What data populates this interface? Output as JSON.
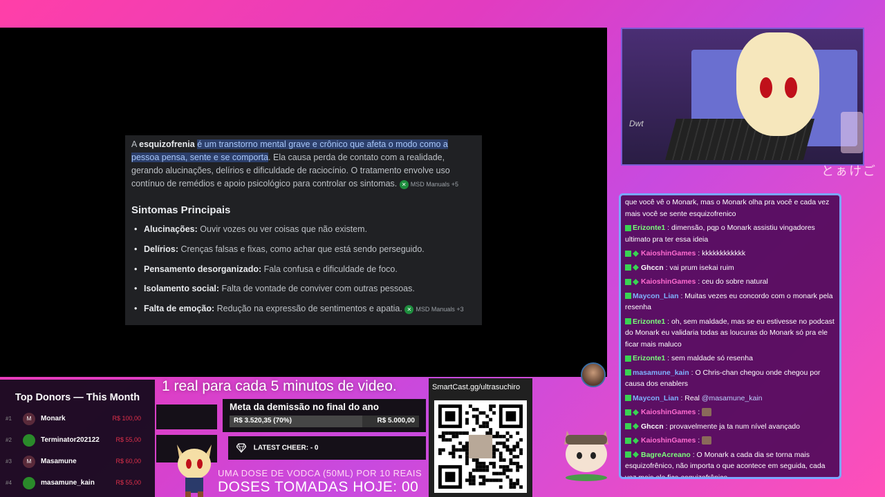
{
  "stream": {
    "card": {
      "p_pre": "A ",
      "p_term": "esquizofrenia",
      "p_hl": "é um transtorno mental grave e crônico que afeta o modo como a pessoa pensa, sente e se comporta",
      "p_rest": ". Ela causa perda de contato com a realidade, gerando alucinações, delírios e dificuldade de raciocínio. O tratamento envolve uso contínuo de remédios e apoio psicológico para controlar os sintomas.",
      "source1": "MSD Manuals +5",
      "heading": "Sintomas Principais",
      "items": [
        {
          "term": "Alucinações:",
          "desc": " Ouvir vozes ou ver coisas que não existem."
        },
        {
          "term": "Delírios:",
          "desc": " Crenças falsas e fixas, como achar que está sendo perseguido."
        },
        {
          "term": "Pensamento desorganizado:",
          "desc": " Fala confusa e dificuldade de foco."
        },
        {
          "term": "Isolamento social:",
          "desc": " Falta de vontade de conviver com outras pessoas."
        },
        {
          "term": "Falta de emoção:",
          "desc": " Redução na expressão de sentimentos e apatia."
        }
      ],
      "source2": "MSD Manuals +3"
    }
  },
  "overlay": {
    "jp_text": "とぁけご",
    "cam_sign": "Dwt"
  },
  "chat": [
    {
      "badges": 0,
      "user": "",
      "color": "white",
      "text": "que você vê o Monark, mas o Monark olha pra você e cada vez mais você se sente esquizofrenico"
    },
    {
      "badges": 1,
      "user": "Erizonte1",
      "color": "green",
      "text": " : dimensão, pqp o Monark assistiu vingadores ultimato pra ter essa ideia"
    },
    {
      "badges": 2,
      "user": "KaioshinGames",
      "color": "pink",
      "text": " : kkkkkkkkkkkk"
    },
    {
      "badges": 2,
      "user": "Ghccn",
      "color": "white",
      "text": " : vai prum isekai ruim"
    },
    {
      "badges": 2,
      "user": "KaioshinGames",
      "color": "pink",
      "text": " : ceu do sobre natural"
    },
    {
      "badges": 1,
      "user": "Maycon_Lian",
      "color": "blue",
      "text": " : Muitas vezes eu concordo com o monark pela resenha"
    },
    {
      "badges": 1,
      "user": "Erizonte1",
      "color": "green",
      "text": " : oh, sem maldade, mas se eu estivesse no podcast do Monark eu validaria todas as loucuras do Monark só pra ele ficar mais maluco"
    },
    {
      "badges": 1,
      "user": "Erizonte1",
      "color": "green",
      "text": " : sem maldade só resenha"
    },
    {
      "badges": 1,
      "user": "masamune_kain",
      "color": "blue",
      "text": " : O Chris-chan chegou onde chegou por causa dos enablers"
    },
    {
      "badges": 1,
      "user": "Maycon_Lian",
      "color": "blue",
      "text": " : Real ",
      "mention": "@masamune_kain"
    },
    {
      "badges": 2,
      "user": "KaioshinGames",
      "color": "pink",
      "text": " :",
      "emote": true
    },
    {
      "badges": 2,
      "user": "Ghccn",
      "color": "white",
      "text": " : provavelmente ja ta num nível avançado"
    },
    {
      "badges": 2,
      "user": "KaioshinGames",
      "color": "pink",
      "text": " :",
      "emote": true
    },
    {
      "badges": 2,
      "user": "BagreAcreano",
      "color": "green",
      "text": " : O Monark a cada dia se torna mais esquizofrênico, não importa o que acontece em seguida, cada vez mais ele fica esquizofrênico"
    }
  ],
  "donors": {
    "title": "Top Donors — This Month",
    "rows": [
      {
        "rank": "#1",
        "initial": "M",
        "green": false,
        "name": "Monark",
        "amount": "R$ 100,00"
      },
      {
        "rank": "#2",
        "initial": "",
        "green": true,
        "name": "Terminator202122",
        "amount": "R$ 55,00"
      },
      {
        "rank": "#3",
        "initial": "M",
        "green": false,
        "name": "Masamune",
        "amount": "R$ 60,00"
      },
      {
        "rank": "#4",
        "initial": "",
        "green": true,
        "name": "masamune_kain",
        "amount": "R$ 55,00"
      }
    ]
  },
  "goal": {
    "header": "1 real para cada 5 minutos de video.",
    "title": "Meta da demissão no final do ano",
    "current": "R$ 3.520,35 (70%)",
    "total": "R$ 5.000,00",
    "progress": 0.7
  },
  "cheer": {
    "label": "LATEST CHEER:  - 0"
  },
  "vodca": {
    "line1": "UMA DOSE DE VODCA (50ML) POR 10 REAIS",
    "line2": "DOSES TOMADAS HOJE: 00"
  },
  "qr": {
    "url": "SmartCast.gg/ultrasuchiro"
  },
  "colors": {
    "accent_pink": "#ff3fa8",
    "chat_border": "#7aa7ff",
    "donor_amount": "#e0304a",
    "highlight": "#a8c7fa"
  }
}
